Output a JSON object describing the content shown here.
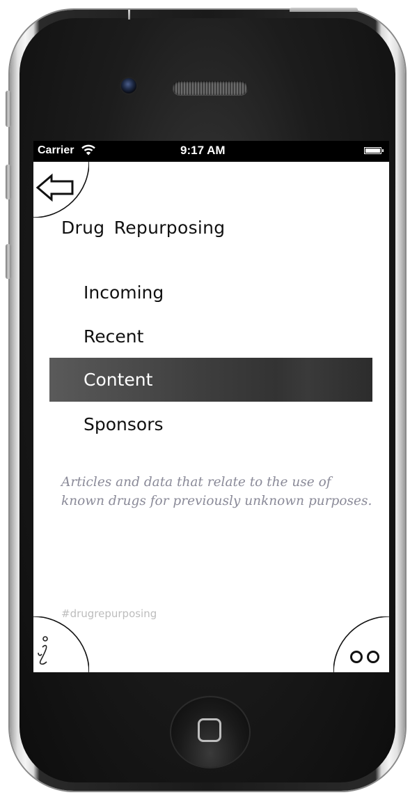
{
  "status_bar": {
    "carrier": "Carrier",
    "wifi_icon": "wifi-icon",
    "time": "9:17 AM",
    "battery_icon": "battery-icon"
  },
  "nav": {
    "back_icon": "left-arrow-icon",
    "info_icon": "info-icon",
    "more_icon": "eyes-icon"
  },
  "page": {
    "title": "Drug Repurposing",
    "menu": [
      {
        "label": "Incoming",
        "active": false
      },
      {
        "label": "Recent",
        "active": false
      },
      {
        "label": "Content",
        "active": true
      },
      {
        "label": "Sponsors",
        "active": false
      }
    ],
    "description": "Articles and data that relate to the use of known drugs for previously unknown purposes.",
    "hashtag": "#drugrepurposing"
  },
  "colors": {
    "active_item_background": "#3f3f3f",
    "active_item_text": "#ffffff",
    "description_text": "#8a8a98",
    "hashtag_text": "#bdbdbd"
  }
}
